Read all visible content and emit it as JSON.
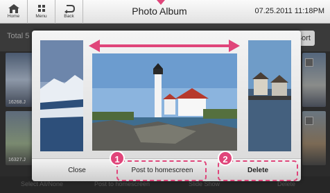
{
  "topbar": {
    "home_label": "Home",
    "menu_label": "Menu",
    "back_label": "Back",
    "title": "Photo Album",
    "datetime": "07.25.2011 11:18PM"
  },
  "background": {
    "total_label": "Total 5",
    "sort_label": "Sort",
    "thumb_caption_1": "16268.J",
    "thumb_caption_2": "16327.J",
    "bottom_buttons": [
      "Select All/None",
      "Post to homescreen",
      "Slide Show",
      "Delete"
    ]
  },
  "dialog": {
    "close_label": "Close",
    "post_label": "Post to homescreen",
    "delete_label": "Delete"
  },
  "callouts": {
    "one": "1",
    "two": "2"
  },
  "colors": {
    "highlight": "#e0457a"
  },
  "icons": {
    "home": "home-icon",
    "menu": "menu-grid-icon",
    "back": "back-arrow-icon",
    "swipe": "double-arrow-icon"
  }
}
